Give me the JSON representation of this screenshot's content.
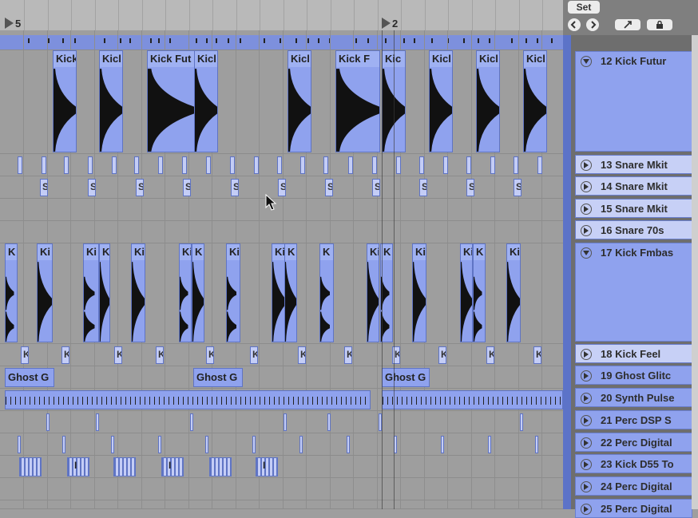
{
  "ruler": {
    "marker_left": "5",
    "marker_right": "2"
  },
  "controls": {
    "set_label": "Set"
  },
  "tracks": [
    {
      "label": "12 Kick Futur"
    },
    {
      "label": "13 Snare Mkit"
    },
    {
      "label": "14 Snare Mkit"
    },
    {
      "label": "15 Snare Mkit"
    },
    {
      "label": "16 Snare 70s"
    },
    {
      "label": "17 Kick Fmbas"
    },
    {
      "label": "18 Kick Feel"
    },
    {
      "label": "19 Ghost Glitc"
    },
    {
      "label": "20 Synth Pulse"
    },
    {
      "label": "21 Perc DSP S"
    },
    {
      "label": "22 Perc Digital"
    },
    {
      "label": "23 Kick D55 To"
    },
    {
      "label": "24 Perc Digital"
    },
    {
      "label": "25 Perc Digital"
    }
  ],
  "lane1_clips": [
    "Kick",
    "Kicl",
    "Kick Fut",
    "Kicl",
    "Kicl",
    "Kick F",
    "Kic",
    "Kicl",
    "Kicl",
    "Kicl"
  ],
  "lane2_clips": [
    "K",
    "Ki",
    "Ki",
    "K",
    "Ki",
    "Ki",
    "K",
    "Ki",
    "Ki",
    "K",
    "K",
    "Ki",
    "K",
    "Ki",
    "Ki",
    "K",
    "Ki"
  ],
  "ghost_clips": [
    "Ghost G",
    "Ghost G",
    "Ghost G"
  ],
  "snare_clips": [
    "S",
    "S",
    "S",
    "S",
    "S",
    "S",
    "S",
    "S",
    "S",
    "S",
    "S"
  ],
  "kick_feel_clips": [
    "K",
    "K",
    "K",
    "K",
    "K",
    "K",
    "K",
    "K",
    "K",
    "K",
    "K",
    "K"
  ],
  "perc_clips": [
    "I",
    "I",
    "I",
    "I",
    "I"
  ],
  "colors": {
    "clip": "#8fa2ee",
    "clip_border": "#5f74c4",
    "lane_bg": "#9e9e9e",
    "track_bg": "#c7d0f6"
  }
}
